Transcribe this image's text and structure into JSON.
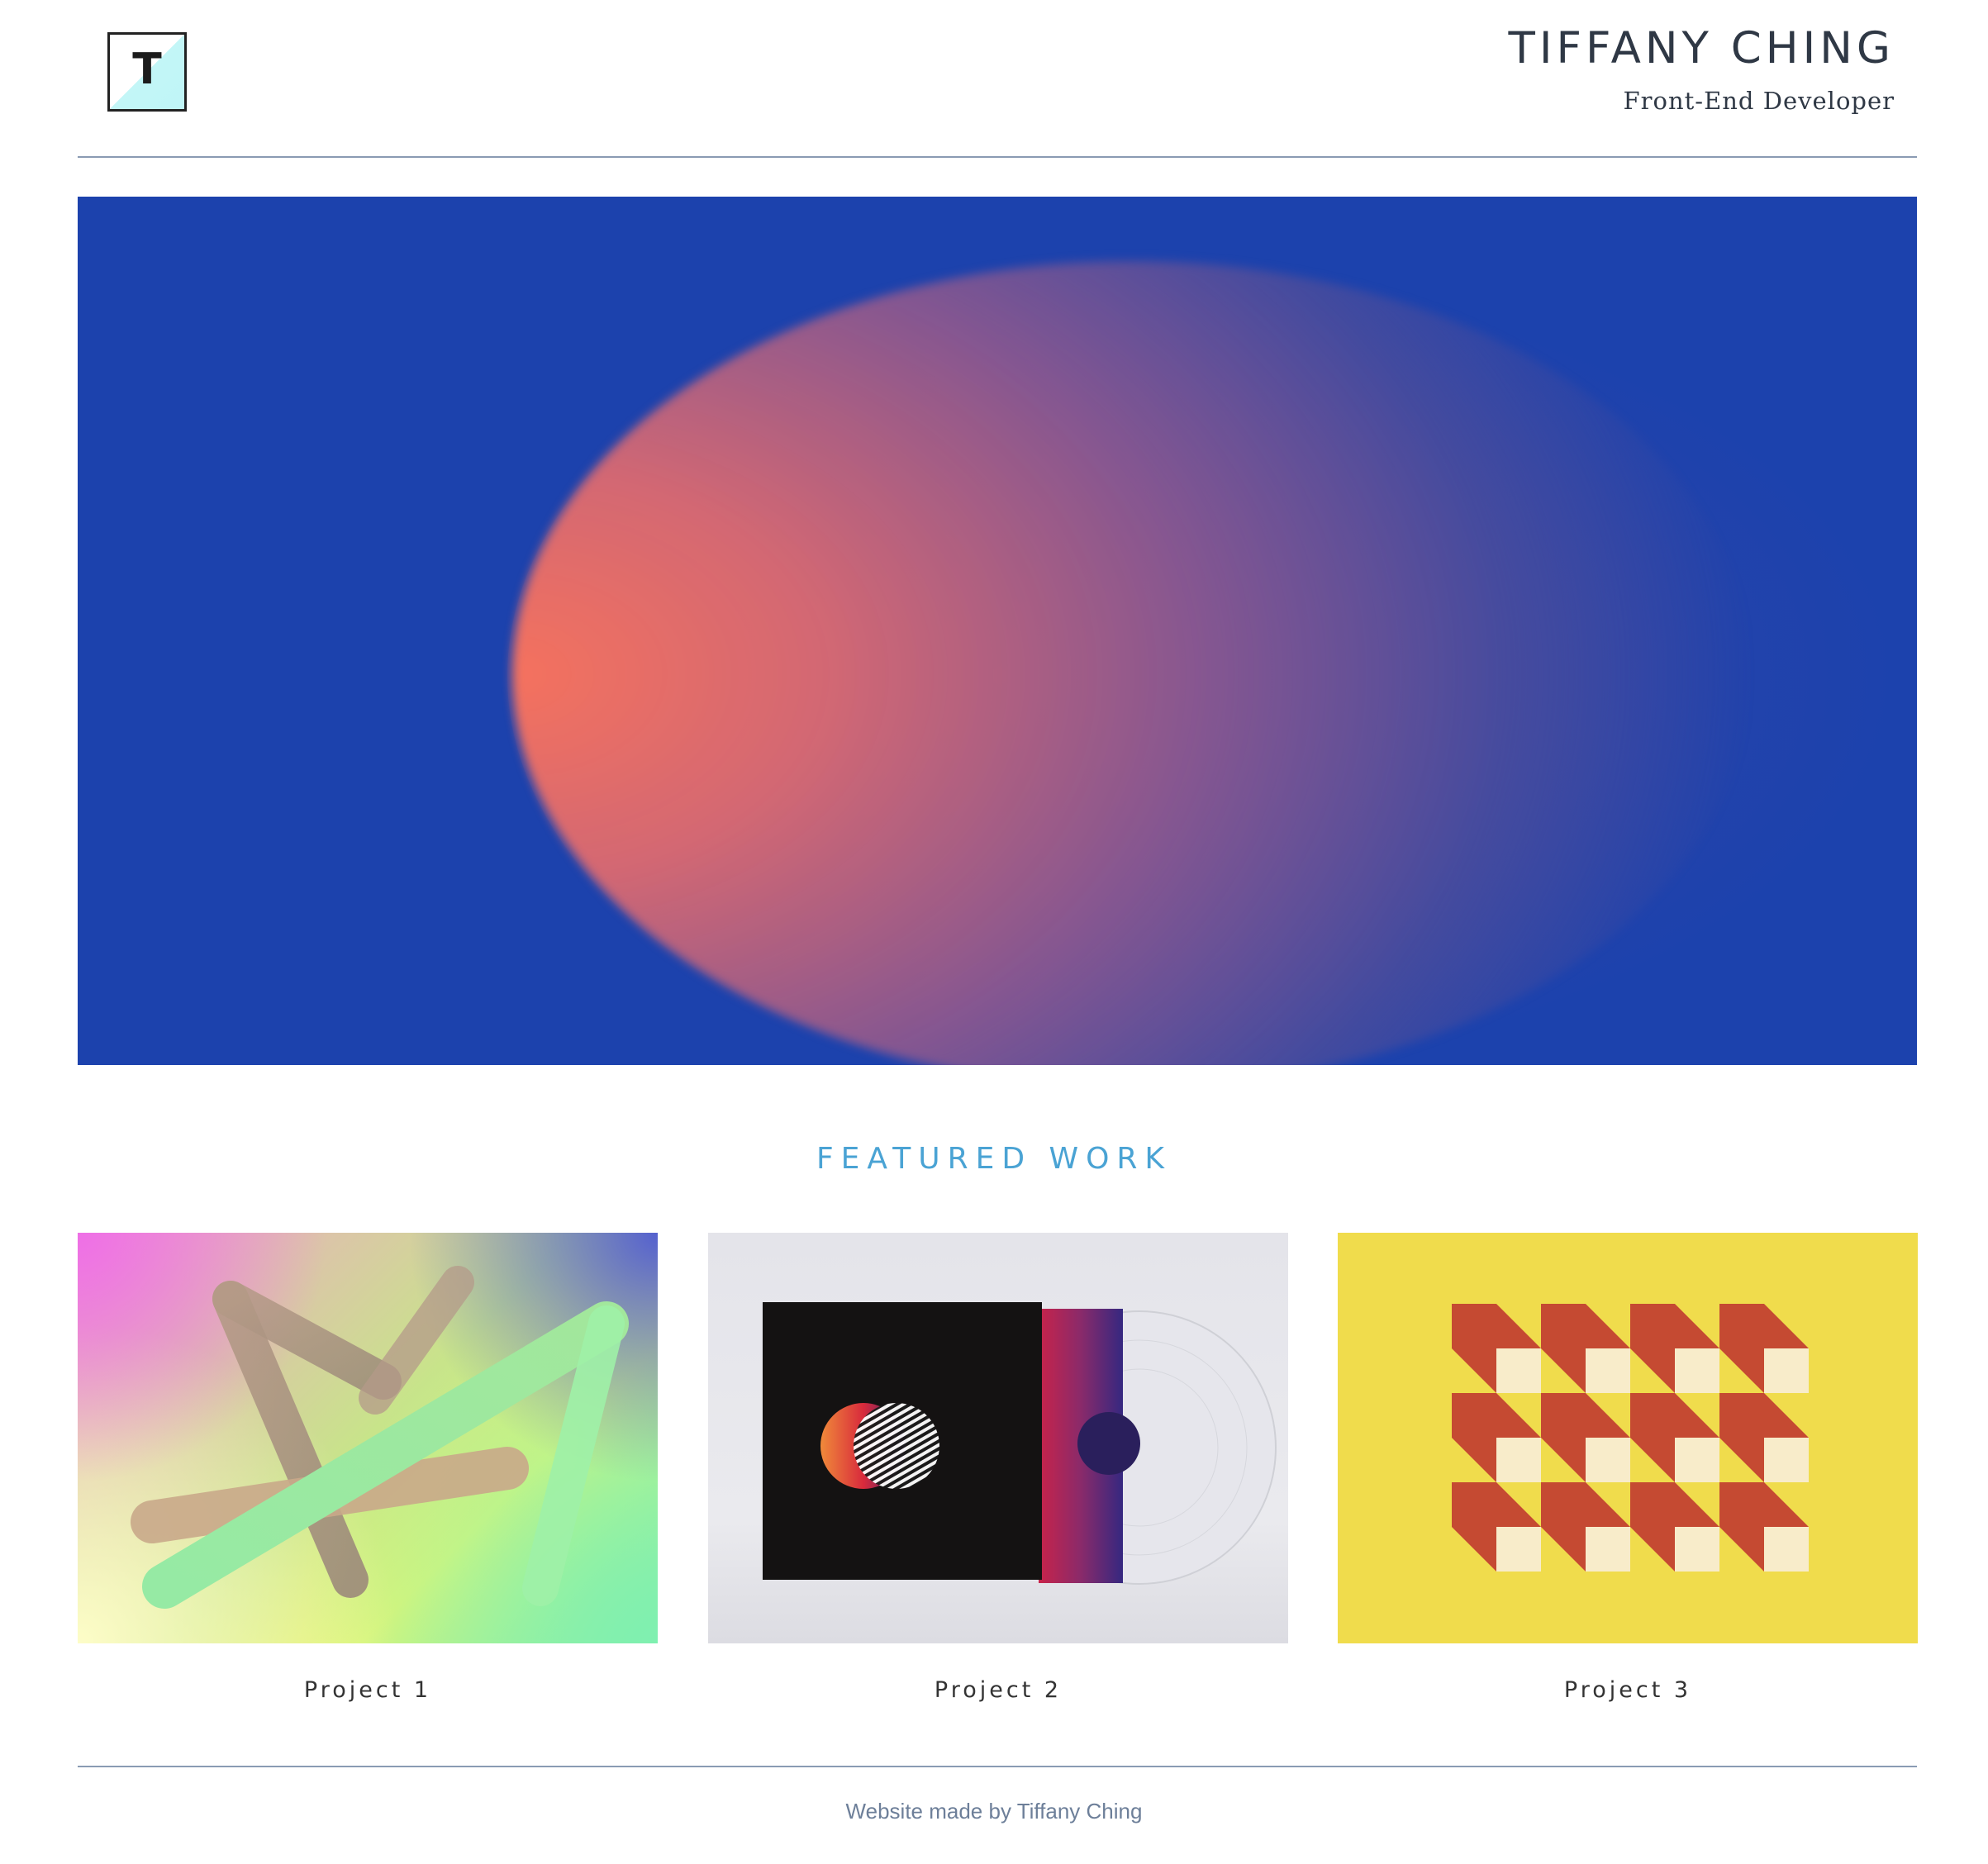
{
  "header": {
    "logo_letter": "T",
    "name": "TIFFANY CHING",
    "role": "Front-End Developer"
  },
  "featured": {
    "title": "FEATURED WORK",
    "projects": [
      {
        "label": "Project 1"
      },
      {
        "label": "Project 2"
      },
      {
        "label": "Project 3"
      }
    ]
  },
  "footer": {
    "text": "Website made by Tiffany Ching"
  },
  "colors": {
    "hero_blue": "#1c42ad",
    "hero_orb": "#f5725e",
    "featured_title": "#4aa3d4",
    "rule": "#8a9bb3",
    "project3_bg": "#f0dc4c",
    "project3_red": "#c54a32",
    "project3_cream": "#f8ecca"
  }
}
